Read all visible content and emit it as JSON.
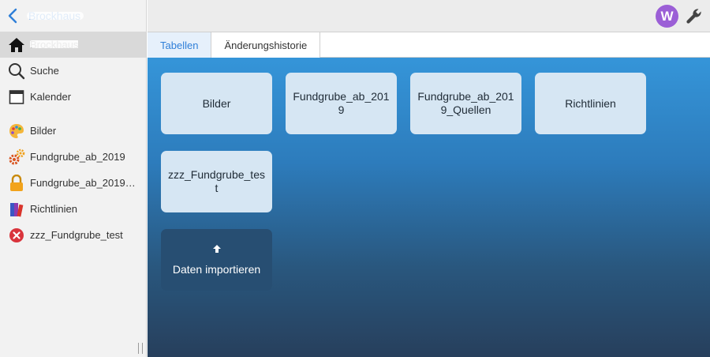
{
  "sidebar": {
    "back_title": "Brockhaus",
    "items": [
      {
        "label": "Brockhaus",
        "icon": "home-icon",
        "active": true
      },
      {
        "label": "Suche",
        "icon": "search-icon"
      },
      {
        "label": "Kalender",
        "icon": "calendar-icon"
      },
      {
        "label": "Bilder",
        "icon": "palette-icon"
      },
      {
        "label": "Fundgrube_ab_2019",
        "icon": "gears-icon"
      },
      {
        "label": "Fundgrube_ab_2019…",
        "icon": "lock-icon"
      },
      {
        "label": "Richtlinien",
        "icon": "books-icon"
      },
      {
        "label": "zzz_Fundgrube_test",
        "icon": "error-icon"
      }
    ]
  },
  "topbar": {
    "avatar_letter": "W",
    "avatar_color": "#9b5fd6"
  },
  "tabs": [
    {
      "label": "Tabellen",
      "active": true
    },
    {
      "label": "Änderungshistorie"
    }
  ],
  "tiles": [
    {
      "label": "Bilder"
    },
    {
      "label": "Fundgrube_ab_2019"
    },
    {
      "label": "Fundgrube_ab_2019_Quellen"
    },
    {
      "label": "Richtlinien"
    },
    {
      "label": "zzz_Fundgrube_test"
    }
  ],
  "import_tile": {
    "label": "Daten importieren",
    "icon": "upload-arrow-icon"
  },
  "colors": {
    "accent": "#2f7fd8",
    "main_top": "#3595d9",
    "main_bottom": "#273f5c"
  }
}
